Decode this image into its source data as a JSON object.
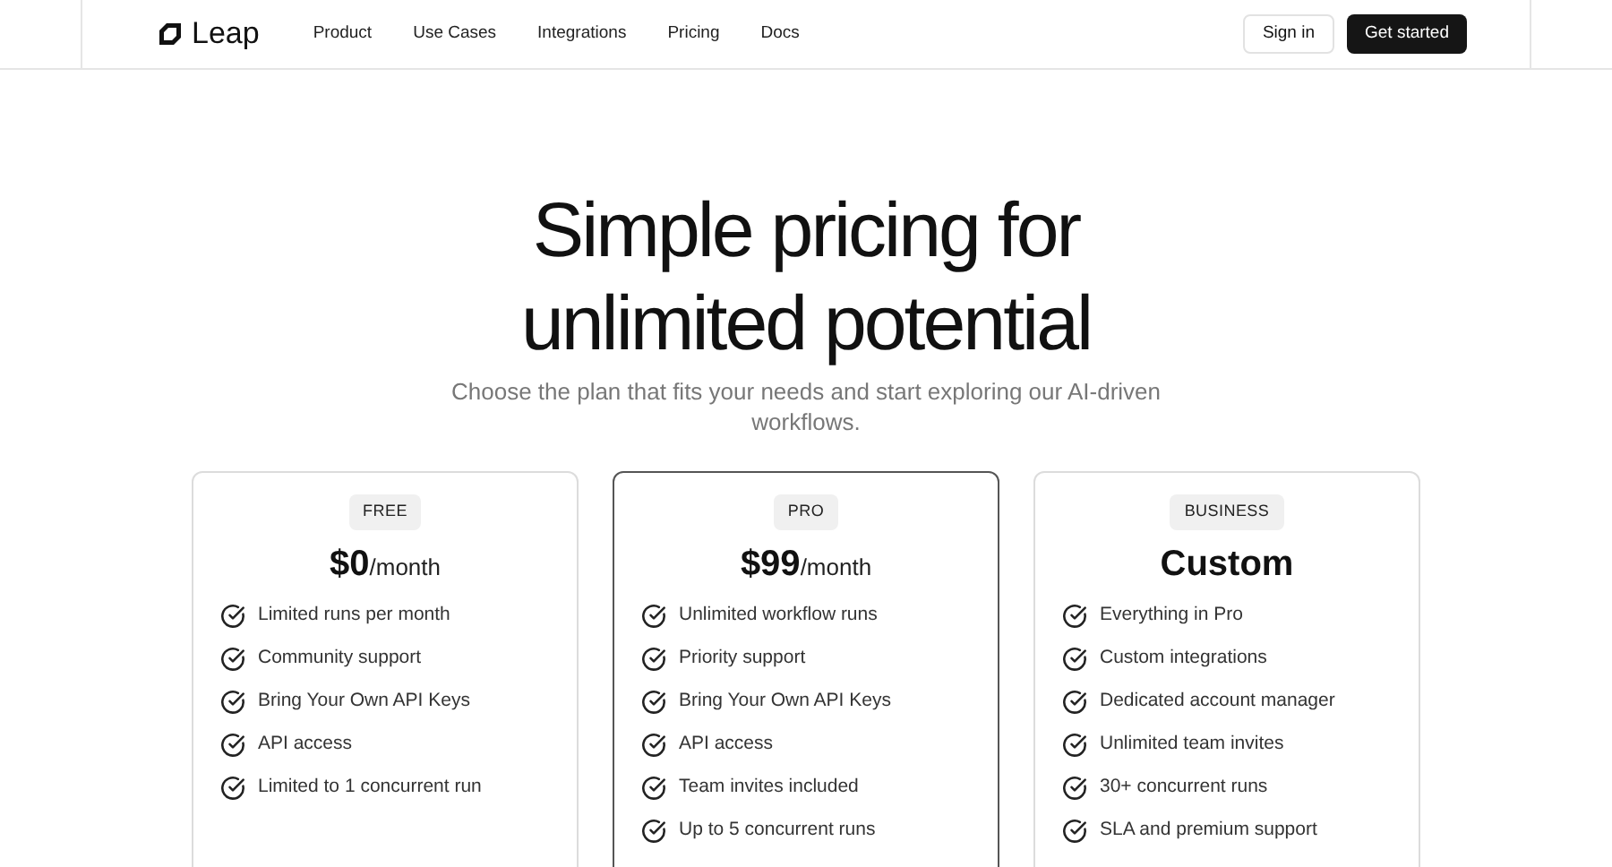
{
  "header": {
    "brand": "Leap",
    "nav": [
      "Product",
      "Use Cases",
      "Integrations",
      "Pricing",
      "Docs"
    ],
    "sign_in": "Sign in",
    "get_started": "Get started"
  },
  "hero": {
    "title_lines": [
      "Simple pricing for",
      "unlimited potential"
    ],
    "subtitle": "Choose the plan that fits your needs and start exploring our AI-driven workflows."
  },
  "plans": [
    {
      "badge": "FREE",
      "price": "$0",
      "period": "/month",
      "highlighted": false,
      "features": [
        "Limited runs per month",
        "Community support",
        "Bring Your Own API Keys",
        "API access",
        "Limited to 1 concurrent run"
      ]
    },
    {
      "badge": "PRO",
      "price": "$99",
      "period": "/month",
      "highlighted": true,
      "features": [
        "Unlimited workflow runs",
        "Priority support",
        "Bring Your Own API Keys",
        "API access",
        "Team invites included",
        "Up to 5 concurrent runs"
      ]
    },
    {
      "badge": "BUSINESS",
      "price": "Custom",
      "highlighted": false,
      "features": [
        "Everything in Pro",
        "Custom integrations",
        "Dedicated account manager",
        "Unlimited team invites",
        "30+ concurrent runs",
        "SLA and premium support"
      ]
    }
  ]
}
